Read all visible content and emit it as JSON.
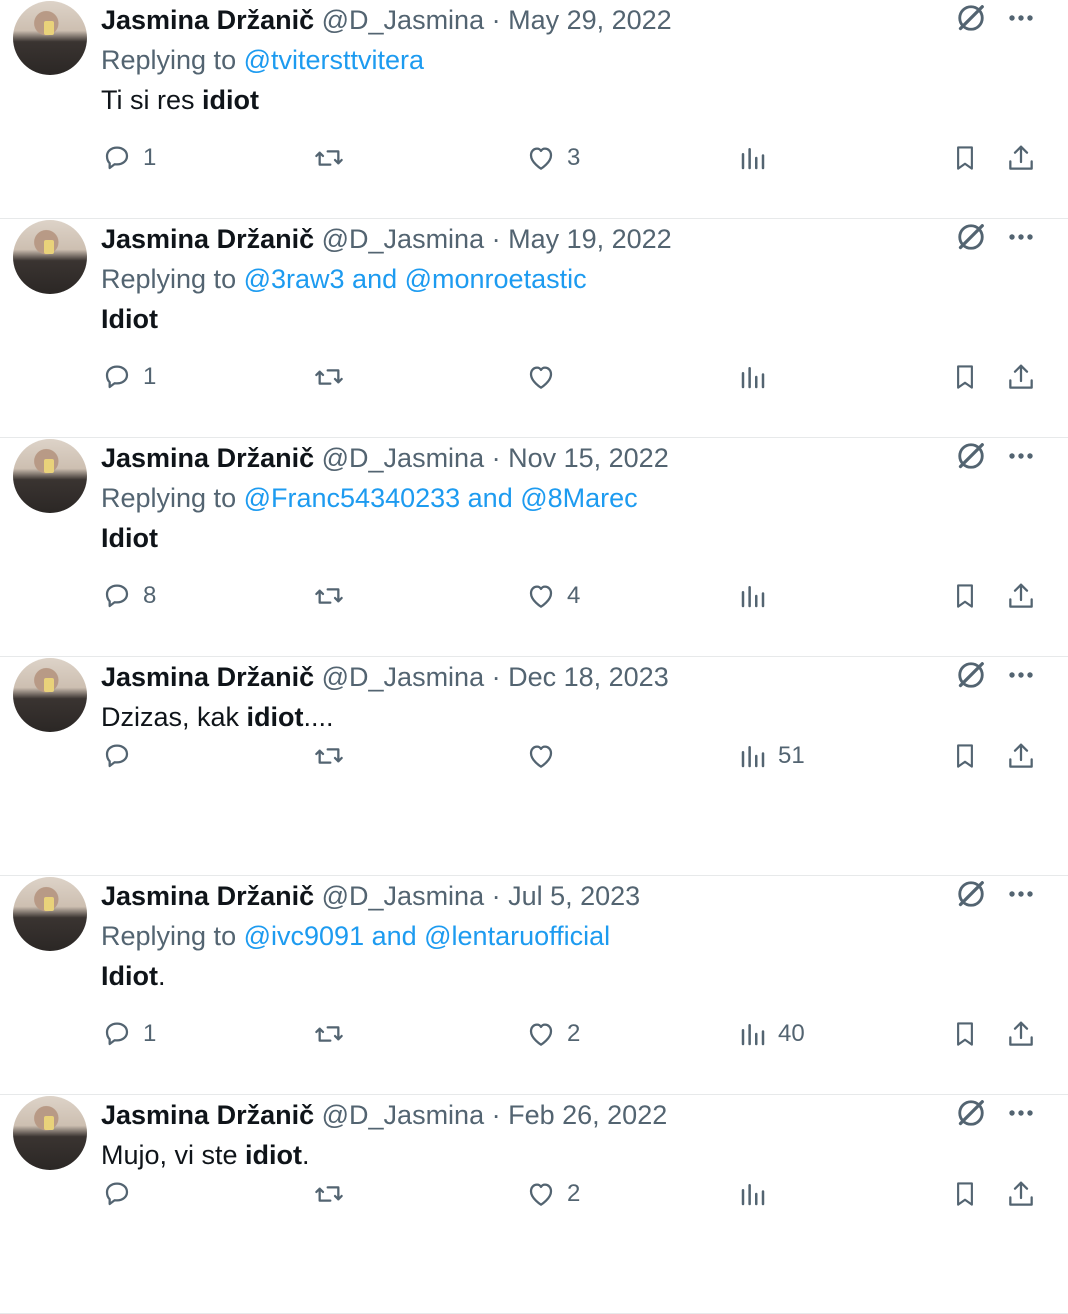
{
  "tweets": [
    {
      "name": "Jasmina Držanič",
      "handle": "@D_Jasmina",
      "date": "May 29, 2022",
      "reply_prefix": "Replying to",
      "reply_to": "@tvitersttvitera",
      "text_before": "Ti si res ",
      "text_bold": "idiot",
      "text_after": "",
      "replies": "1",
      "retweets": "",
      "likes": "3",
      "views": ""
    },
    {
      "name": "Jasmina Držanič",
      "handle": "@D_Jasmina",
      "date": "May 19, 2022",
      "reply_prefix": "Replying to",
      "reply_to": "@3raw3 and @monroetastic",
      "text_before": "",
      "text_bold": "Idiot",
      "text_after": "",
      "replies": "1",
      "retweets": "",
      "likes": "",
      "views": ""
    },
    {
      "name": "Jasmina Držanič",
      "handle": "@D_Jasmina",
      "date": "Nov 15, 2022",
      "reply_prefix": "Replying to",
      "reply_to": "@Franc54340233 and @8Marec",
      "text_before": "",
      "text_bold": "Idiot",
      "text_after": "",
      "replies": "8",
      "retweets": "",
      "likes": "4",
      "views": ""
    },
    {
      "name": "Jasmina Držanič",
      "handle": "@D_Jasmina",
      "date": "Dec 18, 2023",
      "reply_prefix": "",
      "reply_to": "",
      "text_before": "Dzizas, kak ",
      "text_bold": "idiot",
      "text_after": "....",
      "replies": "",
      "retweets": "",
      "likes": "",
      "views": "51"
    },
    {
      "name": "Jasmina Držanič",
      "handle": "@D_Jasmina",
      "date": "Jul 5, 2023",
      "reply_prefix": "Replying to",
      "reply_to": "@ivc9091 and @lentaruofficial",
      "text_before": "",
      "text_bold": "Idiot",
      "text_after": ".",
      "replies": "1",
      "retweets": "",
      "likes": "2",
      "views": "40"
    },
    {
      "name": "Jasmina Držanič",
      "handle": "@D_Jasmina",
      "date": "Feb 26, 2022",
      "reply_prefix": "",
      "reply_to": "",
      "text_before": "Mujo, vi ste ",
      "text_bold": "idiot",
      "text_after": ".",
      "replies": "",
      "retweets": "",
      "likes": "2",
      "views": ""
    }
  ],
  "icons": {
    "reply": "reply-icon",
    "retweet": "retweet-icon",
    "like": "like-icon",
    "views": "views-icon",
    "bookmark": "bookmark-icon",
    "share": "share-icon",
    "grok": "grok-icon",
    "more": "more-icon"
  },
  "colors": {
    "text": "#0f1419",
    "secondary": "#536471",
    "link": "#1d9bf0",
    "divider": "#e7e9ea"
  }
}
